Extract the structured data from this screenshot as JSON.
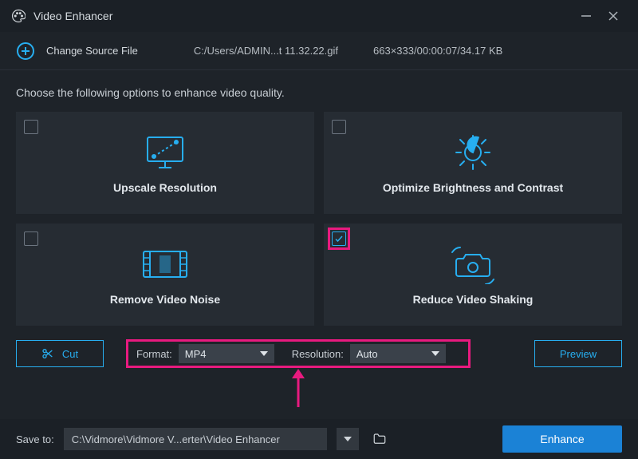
{
  "app": {
    "title": "Video Enhancer"
  },
  "source": {
    "change_label": "Change Source File",
    "path": "C:/Users/ADMIN...t 11.32.22.gif",
    "info": "663×333/00:00:07/34.17 KB"
  },
  "prompt": "Choose the following options to enhance video quality.",
  "cards": [
    {
      "label": "Upscale Resolution",
      "checked": false
    },
    {
      "label": "Optimize Brightness and Contrast",
      "checked": false
    },
    {
      "label": "Remove Video Noise",
      "checked": false
    },
    {
      "label": "Reduce Video Shaking",
      "checked": true
    }
  ],
  "cut_label": "Cut",
  "format": {
    "label": "Format:",
    "value": "MP4"
  },
  "resolution": {
    "label": "Resolution:",
    "value": "Auto"
  },
  "preview_label": "Preview",
  "footer": {
    "save_label": "Save to:",
    "path": "C:\\Vidmore\\Vidmore V...erter\\Video Enhancer",
    "enhance_label": "Enhance"
  },
  "colors": {
    "accent": "#27aef0",
    "highlight": "#e81a7f",
    "primary": "#1b82d6"
  }
}
